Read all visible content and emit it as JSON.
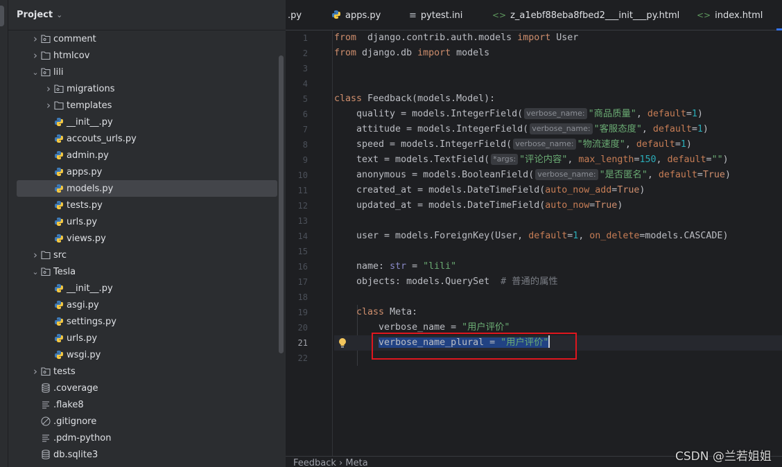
{
  "sidebar": {
    "title": "Project",
    "items": [
      {
        "label": "comment",
        "level": 1,
        "type": "pkg",
        "expand": "closed"
      },
      {
        "label": "htmlcov",
        "level": 1,
        "type": "folder",
        "expand": "closed"
      },
      {
        "label": "lili",
        "level": 1,
        "type": "pkg",
        "expand": "open"
      },
      {
        "label": "migrations",
        "level": 2,
        "type": "pkg",
        "expand": "closed"
      },
      {
        "label": "templates",
        "level": 2,
        "type": "folder",
        "expand": "closed"
      },
      {
        "label": "__init__.py",
        "level": 2,
        "type": "python"
      },
      {
        "label": "accouts_urls.py",
        "level": 2,
        "type": "python"
      },
      {
        "label": "admin.py",
        "level": 2,
        "type": "python"
      },
      {
        "label": "apps.py",
        "level": 2,
        "type": "python"
      },
      {
        "label": "models.py",
        "level": 2,
        "type": "python",
        "selected": true
      },
      {
        "label": "tests.py",
        "level": 2,
        "type": "python"
      },
      {
        "label": "urls.py",
        "level": 2,
        "type": "python"
      },
      {
        "label": "views.py",
        "level": 2,
        "type": "python"
      },
      {
        "label": "src",
        "level": 1,
        "type": "folder",
        "expand": "closed"
      },
      {
        "label": "Tesla",
        "level": 1,
        "type": "pkg",
        "expand": "open"
      },
      {
        "label": "__init__.py",
        "level": 2,
        "type": "python"
      },
      {
        "label": "asgi.py",
        "level": 2,
        "type": "python"
      },
      {
        "label": "settings.py",
        "level": 2,
        "type": "python"
      },
      {
        "label": "urls.py",
        "level": 2,
        "type": "python"
      },
      {
        "label": "wsgi.py",
        "level": 2,
        "type": "python"
      },
      {
        "label": "tests",
        "level": 1,
        "type": "pkg",
        "expand": "closed"
      },
      {
        "label": ".coverage",
        "level": 1,
        "type": "db"
      },
      {
        "label": ".flake8",
        "level": 1,
        "type": "text"
      },
      {
        "label": ".gitignore",
        "level": 1,
        "type": "ignore"
      },
      {
        "label": ".pdm-python",
        "level": 1,
        "type": "text"
      },
      {
        "label": "db.sqlite3",
        "level": 1,
        "type": "db"
      }
    ]
  },
  "tabs": [
    {
      "label": ".py",
      "icon": "none"
    },
    {
      "label": "apps.py",
      "icon": "python"
    },
    {
      "label": "pytest.ini",
      "icon": "text"
    },
    {
      "label": "z_a1ebf88eba8fbed2___init___py.html",
      "icon": "html"
    },
    {
      "label": "index.html",
      "icon": "html"
    }
  ],
  "editor": {
    "current_line": 21,
    "lines": [
      [
        [
          "kw",
          "from"
        ],
        [
          "",
          "  django.contrib.auth.models "
        ],
        [
          "kw",
          "import"
        ],
        [
          "",
          " User"
        ]
      ],
      [
        [
          "kw",
          "from"
        ],
        [
          "",
          " django.db "
        ],
        [
          "kw",
          "import"
        ],
        [
          "",
          " models"
        ]
      ],
      [],
      [],
      [
        [
          "kw",
          "class"
        ],
        [
          "",
          " Feedback(models.Model):"
        ]
      ],
      [
        [
          "",
          "    quality = models.IntegerField("
        ],
        [
          "hint",
          "verbose_name:"
        ],
        [
          "str",
          "\"商品质量\""
        ],
        [
          "",
          ", "
        ],
        [
          "par",
          "default"
        ],
        [
          "",
          "="
        ],
        [
          "num",
          "1"
        ],
        [
          "",
          ")"
        ]
      ],
      [
        [
          "",
          "    attitude = models.IntegerField("
        ],
        [
          "hint",
          "verbose_name:"
        ],
        [
          "str",
          "\"客服态度\""
        ],
        [
          "",
          ", "
        ],
        [
          "par",
          "default"
        ],
        [
          "",
          "="
        ],
        [
          "num",
          "1"
        ],
        [
          "",
          ")"
        ]
      ],
      [
        [
          "",
          "    speed = models.IntegerField("
        ],
        [
          "hint",
          "verbose_name:"
        ],
        [
          "str",
          "\"物流速度\""
        ],
        [
          "",
          ", "
        ],
        [
          "par",
          "default"
        ],
        [
          "",
          "="
        ],
        [
          "num",
          "1"
        ],
        [
          "",
          ")"
        ]
      ],
      [
        [
          "",
          "    text = models.TextField("
        ],
        [
          "hint",
          "*args:"
        ],
        [
          "str",
          "\"评论内容\""
        ],
        [
          "",
          ", "
        ],
        [
          "par",
          "max_length"
        ],
        [
          "",
          "="
        ],
        [
          "num",
          "150"
        ],
        [
          "",
          ", "
        ],
        [
          "par",
          "default"
        ],
        [
          "",
          "="
        ],
        [
          "str",
          "\"\""
        ],
        [
          "",
          ")"
        ]
      ],
      [
        [
          "",
          "    anonymous = models.BooleanField("
        ],
        [
          "hint",
          "verbose_name:"
        ],
        [
          "str",
          "\"是否匿名\""
        ],
        [
          "",
          ", "
        ],
        [
          "par",
          "default"
        ],
        [
          "",
          "="
        ],
        [
          "kw",
          "True"
        ],
        [
          "",
          ")"
        ]
      ],
      [
        [
          "",
          "    created_at = models.DateTimeField("
        ],
        [
          "par",
          "auto_now_add"
        ],
        [
          "",
          "="
        ],
        [
          "kw",
          "True"
        ],
        [
          "",
          ")"
        ]
      ],
      [
        [
          "",
          "    updated_at = models.DateTimeField("
        ],
        [
          "par",
          "auto_now"
        ],
        [
          "",
          "="
        ],
        [
          "kw",
          "True"
        ],
        [
          "",
          ")"
        ]
      ],
      [],
      [
        [
          "",
          "    user = models.ForeignKey(User, "
        ],
        [
          "par",
          "default"
        ],
        [
          "",
          "="
        ],
        [
          "num",
          "1"
        ],
        [
          "",
          ", "
        ],
        [
          "par",
          "on_delete"
        ],
        [
          "",
          "=models.CASCADE)"
        ]
      ],
      [],
      [
        [
          "",
          "    name: "
        ],
        [
          "bi",
          "str"
        ],
        [
          "",
          " = "
        ],
        [
          "str",
          "\"lili\""
        ]
      ],
      [
        [
          "",
          "    objects: models.QuerySet  "
        ],
        [
          "cm",
          "# 普通的属性"
        ]
      ],
      [],
      [
        [
          "",
          "    "
        ],
        [
          "kw",
          "class"
        ],
        [
          "",
          " Meta:"
        ]
      ],
      [
        [
          "",
          "        verbose_name = "
        ],
        [
          "str",
          "\"用户评价\""
        ]
      ],
      [
        [
          "",
          "        "
        ],
        [
          "sel",
          "verbose_name_plural = "
        ],
        [
          "selstr",
          "\"用户评价\""
        ],
        [
          "caret",
          ""
        ]
      ],
      []
    ]
  },
  "breadcrumb": [
    "Feedback",
    "Meta"
  ],
  "watermark": "CSDN @兰若姐姐",
  "colors": {
    "keyword": "#cf8e6d",
    "string": "#6aab73",
    "number": "#2aacb8",
    "selection": "#214283",
    "highlight_box": "#e0161e"
  }
}
